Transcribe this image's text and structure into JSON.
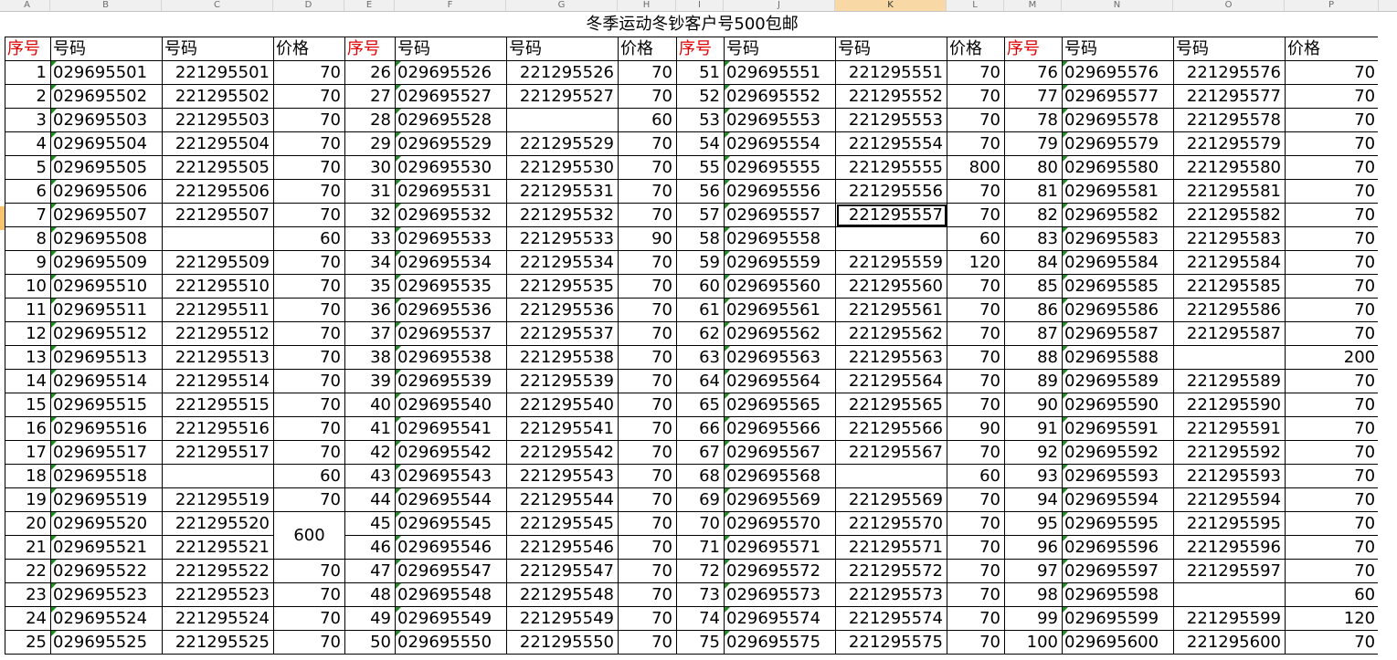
{
  "column_headers": [
    "A",
    "B",
    "C",
    "D",
    "E",
    "F",
    "G",
    "H",
    "I",
    "J",
    "K",
    "L",
    "M",
    "N",
    "O",
    "P"
  ],
  "selected_column": "K",
  "selected_row": 7,
  "title": "冬季运动冬钞客户号500包邮",
  "headers": [
    "序号",
    "号码",
    "号码",
    "价格",
    "序号",
    "号码",
    "号码",
    "价格",
    "序号",
    "号码",
    "号码",
    "价格",
    "序号",
    "号码",
    "号码",
    "价格"
  ],
  "merged_price": {
    "row_index": 19,
    "group": 0,
    "value": "600"
  },
  "rows": [
    [
      [
        "1",
        "029695501",
        "221295501",
        "70"
      ],
      [
        "26",
        "029695526",
        "221295526",
        "70"
      ],
      [
        "51",
        "029695551",
        "221295551",
        "70"
      ],
      [
        "76",
        "029695576",
        "221295576",
        "70"
      ]
    ],
    [
      [
        "2",
        "029695502",
        "221295502",
        "70"
      ],
      [
        "27",
        "029695527",
        "221295527",
        "70"
      ],
      [
        "52",
        "029695552",
        "221295552",
        "70"
      ],
      [
        "77",
        "029695577",
        "221295577",
        "70"
      ]
    ],
    [
      [
        "3",
        "029695503",
        "221295503",
        "70"
      ],
      [
        "28",
        "029695528",
        "",
        "60"
      ],
      [
        "53",
        "029695553",
        "221295553",
        "70"
      ],
      [
        "78",
        "029695578",
        "221295578",
        "70"
      ]
    ],
    [
      [
        "4",
        "029695504",
        "221295504",
        "70"
      ],
      [
        "29",
        "029695529",
        "221295529",
        "70"
      ],
      [
        "54",
        "029695554",
        "221295554",
        "70"
      ],
      [
        "79",
        "029695579",
        "221295579",
        "70"
      ]
    ],
    [
      [
        "5",
        "029695505",
        "221295505",
        "70"
      ],
      [
        "30",
        "029695530",
        "221295530",
        "70"
      ],
      [
        "55",
        "029695555",
        "221295555",
        "800"
      ],
      [
        "80",
        "029695580",
        "221295580",
        "70"
      ]
    ],
    [
      [
        "6",
        "029695506",
        "221295506",
        "70"
      ],
      [
        "31",
        "029695531",
        "221295531",
        "70"
      ],
      [
        "56",
        "029695556",
        "221295556",
        "70"
      ],
      [
        "81",
        "029695581",
        "221295581",
        "70"
      ]
    ],
    [
      [
        "7",
        "029695507",
        "221295507",
        "70"
      ],
      [
        "32",
        "029695532",
        "221295532",
        "70"
      ],
      [
        "57",
        "029695557",
        "221295557",
        "70"
      ],
      [
        "82",
        "029695582",
        "221295582",
        "70"
      ]
    ],
    [
      [
        "8",
        "029695508",
        "",
        "60"
      ],
      [
        "33",
        "029695533",
        "221295533",
        "90"
      ],
      [
        "58",
        "029695558",
        "",
        "60"
      ],
      [
        "83",
        "029695583",
        "221295583",
        "70"
      ]
    ],
    [
      [
        "9",
        "029695509",
        "221295509",
        "70"
      ],
      [
        "34",
        "029695534",
        "221295534",
        "70"
      ],
      [
        "59",
        "029695559",
        "221295559",
        "120"
      ],
      [
        "84",
        "029695584",
        "221295584",
        "70"
      ]
    ],
    [
      [
        "10",
        "029695510",
        "221295510",
        "70"
      ],
      [
        "35",
        "029695535",
        "221295535",
        "70"
      ],
      [
        "60",
        "029695560",
        "221295560",
        "70"
      ],
      [
        "85",
        "029695585",
        "221295585",
        "70"
      ]
    ],
    [
      [
        "11",
        "029695511",
        "221295511",
        "70"
      ],
      [
        "36",
        "029695536",
        "221295536",
        "70"
      ],
      [
        "61",
        "029695561",
        "221295561",
        "70"
      ],
      [
        "86",
        "029695586",
        "221295586",
        "70"
      ]
    ],
    [
      [
        "12",
        "029695512",
        "221295512",
        "70"
      ],
      [
        "37",
        "029695537",
        "221295537",
        "70"
      ],
      [
        "62",
        "029695562",
        "221295562",
        "70"
      ],
      [
        "87",
        "029695587",
        "221295587",
        "70"
      ]
    ],
    [
      [
        "13",
        "029695513",
        "221295513",
        "70"
      ],
      [
        "38",
        "029695538",
        "221295538",
        "70"
      ],
      [
        "63",
        "029695563",
        "221295563",
        "70"
      ],
      [
        "88",
        "029695588",
        "",
        "200"
      ]
    ],
    [
      [
        "14",
        "029695514",
        "221295514",
        "70"
      ],
      [
        "39",
        "029695539",
        "221295539",
        "70"
      ],
      [
        "64",
        "029695564",
        "221295564",
        "70"
      ],
      [
        "89",
        "029695589",
        "221295589",
        "70"
      ]
    ],
    [
      [
        "15",
        "029695515",
        "221295515",
        "70"
      ],
      [
        "40",
        "029695540",
        "221295540",
        "70"
      ],
      [
        "65",
        "029695565",
        "221295565",
        "70"
      ],
      [
        "90",
        "029695590",
        "221295590",
        "70"
      ]
    ],
    [
      [
        "16",
        "029695516",
        "221295516",
        "70"
      ],
      [
        "41",
        "029695541",
        "221295541",
        "70"
      ],
      [
        "66",
        "029695566",
        "221295566",
        "90"
      ],
      [
        "91",
        "029695591",
        "221295591",
        "70"
      ]
    ],
    [
      [
        "17",
        "029695517",
        "221295517",
        "70"
      ],
      [
        "42",
        "029695542",
        "221295542",
        "70"
      ],
      [
        "67",
        "029695567",
        "221295567",
        "70"
      ],
      [
        "92",
        "029695592",
        "221295592",
        "70"
      ]
    ],
    [
      [
        "18",
        "029695518",
        "",
        "60"
      ],
      [
        "43",
        "029695543",
        "221295543",
        "70"
      ],
      [
        "68",
        "029695568",
        "",
        "60"
      ],
      [
        "93",
        "029695593",
        "221295593",
        "70"
      ]
    ],
    [
      [
        "19",
        "029695519",
        "221295519",
        "70"
      ],
      [
        "44",
        "029695544",
        "221295544",
        "70"
      ],
      [
        "69",
        "029695569",
        "221295569",
        "70"
      ],
      [
        "94",
        "029695594",
        "221295594",
        "70"
      ]
    ],
    [
      [
        "20",
        "029695520",
        "221295520",
        ""
      ],
      [
        "45",
        "029695545",
        "221295545",
        "70"
      ],
      [
        "70",
        "029695570",
        "221295570",
        "70"
      ],
      [
        "95",
        "029695595",
        "221295595",
        "70"
      ]
    ],
    [
      [
        "21",
        "029695521",
        "221295521",
        ""
      ],
      [
        "46",
        "029695546",
        "221295546",
        "70"
      ],
      [
        "71",
        "029695571",
        "221295571",
        "70"
      ],
      [
        "96",
        "029695596",
        "221295596",
        "70"
      ]
    ],
    [
      [
        "22",
        "029695522",
        "221295522",
        "70"
      ],
      [
        "47",
        "029695547",
        "221295547",
        "70"
      ],
      [
        "72",
        "029695572",
        "221295572",
        "70"
      ],
      [
        "97",
        "029695597",
        "221295597",
        "70"
      ]
    ],
    [
      [
        "23",
        "029695523",
        "221295523",
        "70"
      ],
      [
        "48",
        "029695548",
        "221295548",
        "70"
      ],
      [
        "73",
        "029695573",
        "221295573",
        "70"
      ],
      [
        "98",
        "029695598",
        "",
        "60"
      ]
    ],
    [
      [
        "24",
        "029695524",
        "221295524",
        "70"
      ],
      [
        "49",
        "029695549",
        "221295549",
        "70"
      ],
      [
        "74",
        "029695574",
        "221295574",
        "70"
      ],
      [
        "99",
        "029695599",
        "221295599",
        "120"
      ]
    ],
    [
      [
        "25",
        "029695525",
        "221295525",
        "70"
      ],
      [
        "50",
        "029695550",
        "221295550",
        "70"
      ],
      [
        "75",
        "029695575",
        "221295575",
        "70"
      ],
      [
        "100",
        "029695600",
        "221295600",
        "70"
      ]
    ]
  ]
}
